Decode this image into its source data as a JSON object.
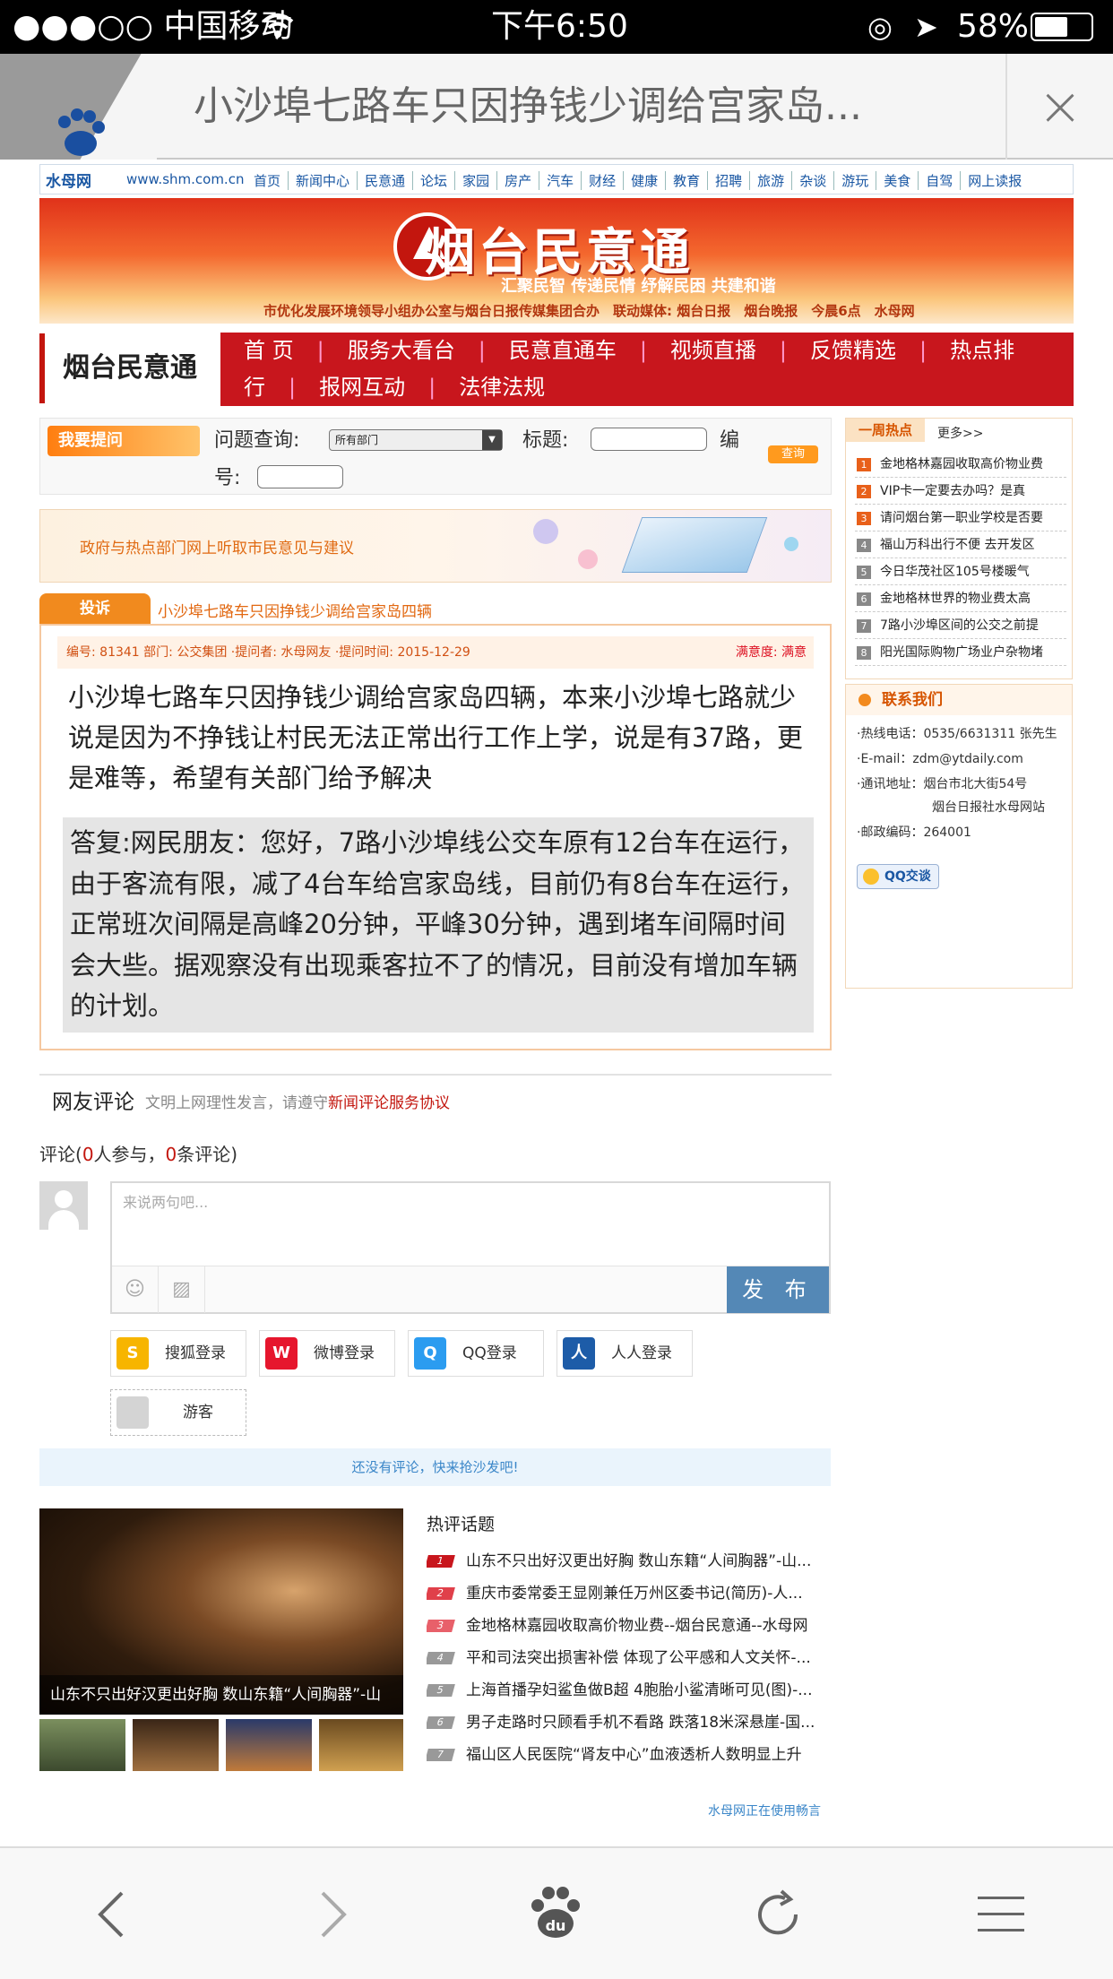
{
  "status_bar": {
    "carrier": "●●●○○ 中国移动",
    "wifi": "wifi-icon",
    "time": "下午6:50",
    "battery": "58%"
  },
  "browser": {
    "title": "小沙埠七路车只因挣钱少调给宫家岛...",
    "close": "×"
  },
  "site_nav": {
    "logo": "水母网",
    "domain": "www.shm.com.cn",
    "links": [
      "首页",
      "新闻中心",
      "民意通",
      "论坛",
      "家园",
      "房产",
      "汽车",
      "财经",
      "健康",
      "教育",
      "招聘",
      "旅游",
      "杂谈",
      "游玩",
      "美食",
      "自驾",
      "网上读报"
    ]
  },
  "banner": {
    "title": "烟台民意通",
    "slogan": "汇聚民智 传递民情 纾解民困 共建和谐",
    "byline": "市优化发展环境领导小组办公室与烟台日报传媒集团合办　联动媒体: 烟台日报　烟台晚报　今晨6点　水母网"
  },
  "section_nav": {
    "label": "烟台民意通",
    "row1": [
      "首 页",
      "服务大看台",
      "民意直通车",
      "视频直播",
      "反馈精选",
      "热点排"
    ],
    "row2": [
      "行",
      "报网互动",
      "法律法规"
    ]
  },
  "query": {
    "ask_button": "我要提问",
    "label_issue": "问题查询:",
    "dept_selected": "所有部门",
    "label_title": "标题:",
    "label_no": "编",
    "label_no2": "号:",
    "search_button": "查询"
  },
  "ad": {
    "text": "政府与热点部门网上听取市民意见与建议"
  },
  "complaint": {
    "tab": "投诉",
    "title": "小沙埠七路车只因挣钱少调给宫家岛四辆",
    "meta": "编号: 81341  部门: 公交集团  ·提问者: 水母网友  ·提问时间: 2015-12-29",
    "satisfaction": "满意度: 满意",
    "question": "小沙埠七路车只因挣钱少调给宫家岛四辆，本来小沙埠七路就少说是因为不挣钱让村民无法正常出行工作上学，说是有37路，更是难等，希望有关部门给予解决",
    "answer": "答复:网民朋友：您好，7路小沙埠线公交车原有12台车在运行，由于客流有限，减了4台车给宫家岛线，目前仍有8台车在运行，正常班次间隔是高峰20分钟，平峰30分钟，遇到堵车间隔时间会大些。据观察没有出现乘客拉不了的情况，目前没有增加车辆的计划。"
  },
  "weekly_hot": {
    "tab": "一周热点",
    "more": "更多>>",
    "items": [
      {
        "n": "1",
        "text": "金地格林嘉园收取高价物业费"
      },
      {
        "n": "2",
        "text": "VIP卡一定要去办吗？是真"
      },
      {
        "n": "3",
        "text": "请问烟台第一职业学校是否要"
      },
      {
        "n": "4",
        "text": "福山万科出行不便 去开发区"
      },
      {
        "n": "5",
        "text": "今日华茂社区105号楼暖气"
      },
      {
        "n": "6",
        "text": "金地格林世界的物业费太高"
      },
      {
        "n": "7",
        "text": "7路小沙埠区间的公交之前提"
      },
      {
        "n": "8",
        "text": "阳光国际购物广场业户杂物堵"
      }
    ]
  },
  "contact": {
    "title": "联系我们",
    "phone": "·热线电话：0535/6631311 张先生",
    "email": "·E-mail：zdm@ytdaily.com",
    "address": "·通讯地址：烟台市北大街54号",
    "address2": "烟台日报社水母网站",
    "postcode": "·邮政编码：264001",
    "qq": "QQ交谈"
  },
  "comments": {
    "title": "网友评论",
    "note": "文明上网理性发言，请遵守",
    "note_link": "新闻评论服务协议",
    "count_prefix": "评论(",
    "participants": "0",
    "count_mid": "人参与，",
    "count": "0",
    "count_suffix": "条评论)",
    "placeholder": "来说两句吧...",
    "publish": "发 布",
    "logins": [
      "搜狐登录",
      "微博登录",
      "QQ登录",
      "人人登录"
    ],
    "guest": "游客",
    "empty": "还没有评论，快来抢沙发吧!"
  },
  "hot_topics": {
    "title": "热评话题",
    "photo_caption": "山东不只出好汉更出好胸 数山东籍“人间胸器”-山",
    "items": [
      {
        "n": "1",
        "text": "山东不只出好汉更出好胸 数山东籍“人间胸器”-山..."
      },
      {
        "n": "2",
        "text": "重庆市委常委王显刚兼任万州区委书记(简历)-人..."
      },
      {
        "n": "3",
        "text": "金地格林嘉园收取高价物业费--烟台民意通--水母网"
      },
      {
        "n": "4",
        "text": "平和司法突出损害补偿 体现了公平感和人文关怀-..."
      },
      {
        "n": "5",
        "text": "上海首播孕妇鲨鱼做B超 4胞胎小鲨清晰可见(图)-..."
      },
      {
        "n": "6",
        "text": "男子走路时只顾看手机不看路 跌落18米深悬崖-国..."
      },
      {
        "n": "7",
        "text": "福山区人民医院“肾友中心”血液透析人数明显上升"
      }
    ],
    "footnote": "水母网正在使用畅言"
  },
  "colors": {
    "brand_red": "#c8161d",
    "accent_orange": "#f18a1e",
    "publish_blue": "#5488b6"
  },
  "toolbar_icons": [
    "back-icon",
    "forward-icon",
    "baidu-paw-icon",
    "refresh-icon",
    "menu-icon"
  ]
}
